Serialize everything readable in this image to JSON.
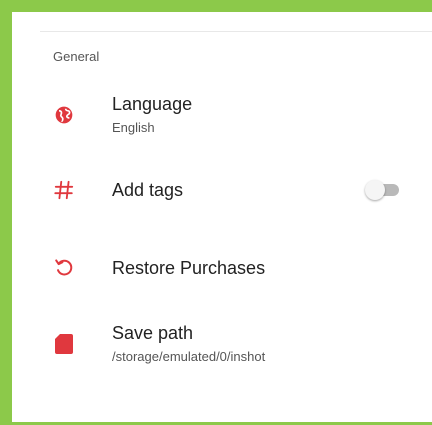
{
  "colors": {
    "accent": "#e0383e",
    "frame": "#8cc94a",
    "toggle_track": "#b9b9b9",
    "toggle_thumb": "#f5f5f5"
  },
  "section": {
    "header": "General"
  },
  "items": [
    {
      "icon": "globe-icon",
      "title": "Language",
      "subtitle": "English"
    },
    {
      "icon": "hashtag-icon",
      "title": "Add tags",
      "toggle_on": false
    },
    {
      "icon": "restore-icon",
      "title": "Restore Purchases"
    },
    {
      "icon": "sd-card-icon",
      "title": "Save path",
      "subtitle": "/storage/emulated/0/inshot"
    }
  ]
}
